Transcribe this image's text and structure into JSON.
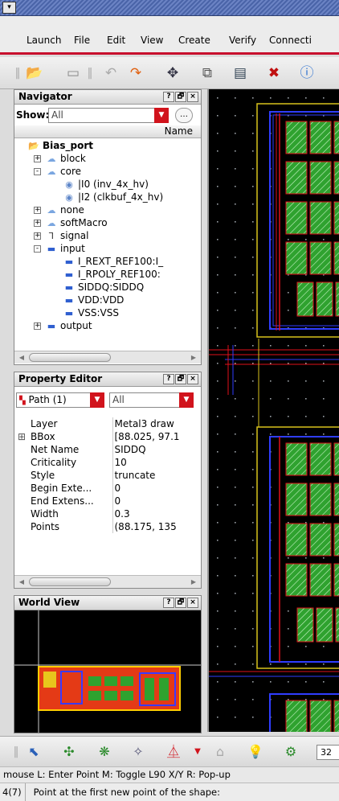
{
  "menubar": {
    "items": [
      {
        "label": "Launch"
      },
      {
        "label": "File"
      },
      {
        "label": "Edit"
      },
      {
        "label": "View"
      },
      {
        "label": "Create"
      },
      {
        "label": "Verify"
      },
      {
        "label": "Connecti"
      }
    ]
  },
  "navigator": {
    "title": "Navigator",
    "show_label": "Show:",
    "show_value": "All",
    "column_header": "Name",
    "tree": [
      {
        "label": "Bias_port",
        "icon": "folder-icon",
        "level": 0,
        "expander": "",
        "bold": true
      },
      {
        "label": "block",
        "icon": "group-icon",
        "level": 1,
        "expander": "+"
      },
      {
        "label": "core",
        "icon": "group-icon",
        "level": 1,
        "expander": "-"
      },
      {
        "label": "|I0  (inv_4x_hv)",
        "icon": "instance-icon",
        "level": 2,
        "expander": ""
      },
      {
        "label": "|I2  (clkbuf_4x_hv)",
        "icon": "instance-icon",
        "level": 2,
        "expander": ""
      },
      {
        "label": "none",
        "icon": "group-icon",
        "level": 1,
        "expander": "+"
      },
      {
        "label": "softMacro",
        "icon": "group-icon",
        "level": 1,
        "expander": "+"
      },
      {
        "label": "signal",
        "icon": "net-icon",
        "level": 1,
        "expander": "+"
      },
      {
        "label": "input",
        "icon": "pin-icon",
        "level": 1,
        "expander": "-"
      },
      {
        "label": "I_REXT_REF100:I_",
        "icon": "pin-icon",
        "level": 2,
        "expander": ""
      },
      {
        "label": "I_RPOLY_REF100:",
        "icon": "pin-icon",
        "level": 2,
        "expander": ""
      },
      {
        "label": "SIDDQ:SIDDQ",
        "icon": "pin-icon",
        "level": 2,
        "expander": ""
      },
      {
        "label": "VDD:VDD",
        "icon": "pin-icon",
        "level": 2,
        "expander": ""
      },
      {
        "label": "VSS:VSS",
        "icon": "pin-icon",
        "level": 2,
        "expander": ""
      },
      {
        "label": "output",
        "icon": "pin-icon",
        "level": 1,
        "expander": "+"
      }
    ],
    "scroll_thumb_label": "IIIII"
  },
  "property_editor": {
    "title": "Property Editor",
    "path_label": "Path (1)",
    "filter_value": "All",
    "rows": [
      {
        "expander": "",
        "name": "Layer",
        "value": "Metal3 draw"
      },
      {
        "expander": "⊞",
        "name": "BBox",
        "value": "[88.025, 97.1"
      },
      {
        "expander": "",
        "name": "Net Name",
        "value": "SIDDQ"
      },
      {
        "expander": "",
        "name": "Criticality",
        "value": "10"
      },
      {
        "expander": "",
        "name": "Style",
        "value": "truncate"
      },
      {
        "expander": "",
        "name": "Begin Exte...",
        "value": "0"
      },
      {
        "expander": "",
        "name": "End Extens...",
        "value": "0"
      },
      {
        "expander": "",
        "name": "Width",
        "value": "0.3"
      },
      {
        "expander": "",
        "name": "Points",
        "value": "(88.175, 135"
      }
    ],
    "scroll_thumb_label": "IIIII"
  },
  "world_view": {
    "title": "World View"
  },
  "panel_buttons": {
    "help": "?",
    "float": "🗗",
    "close": "×"
  },
  "bottom_toolbar": {
    "zoom_value": "32"
  },
  "mouse_bar": {
    "text": "mouse L: Enter Point   M: Toggle L90 X/Y   R: Pop-up"
  },
  "status_bar": {
    "counter": "4(7)",
    "prompt": "Point at the first new point of the shape:"
  },
  "colors": {
    "accent_red": "#d1131c",
    "canvas_bg": "#000000",
    "wire_red": "#e0101a",
    "wire_blue": "#2f3dff",
    "cell_green": "#2fa22f",
    "boundary_yellow": "#d8c21c"
  }
}
